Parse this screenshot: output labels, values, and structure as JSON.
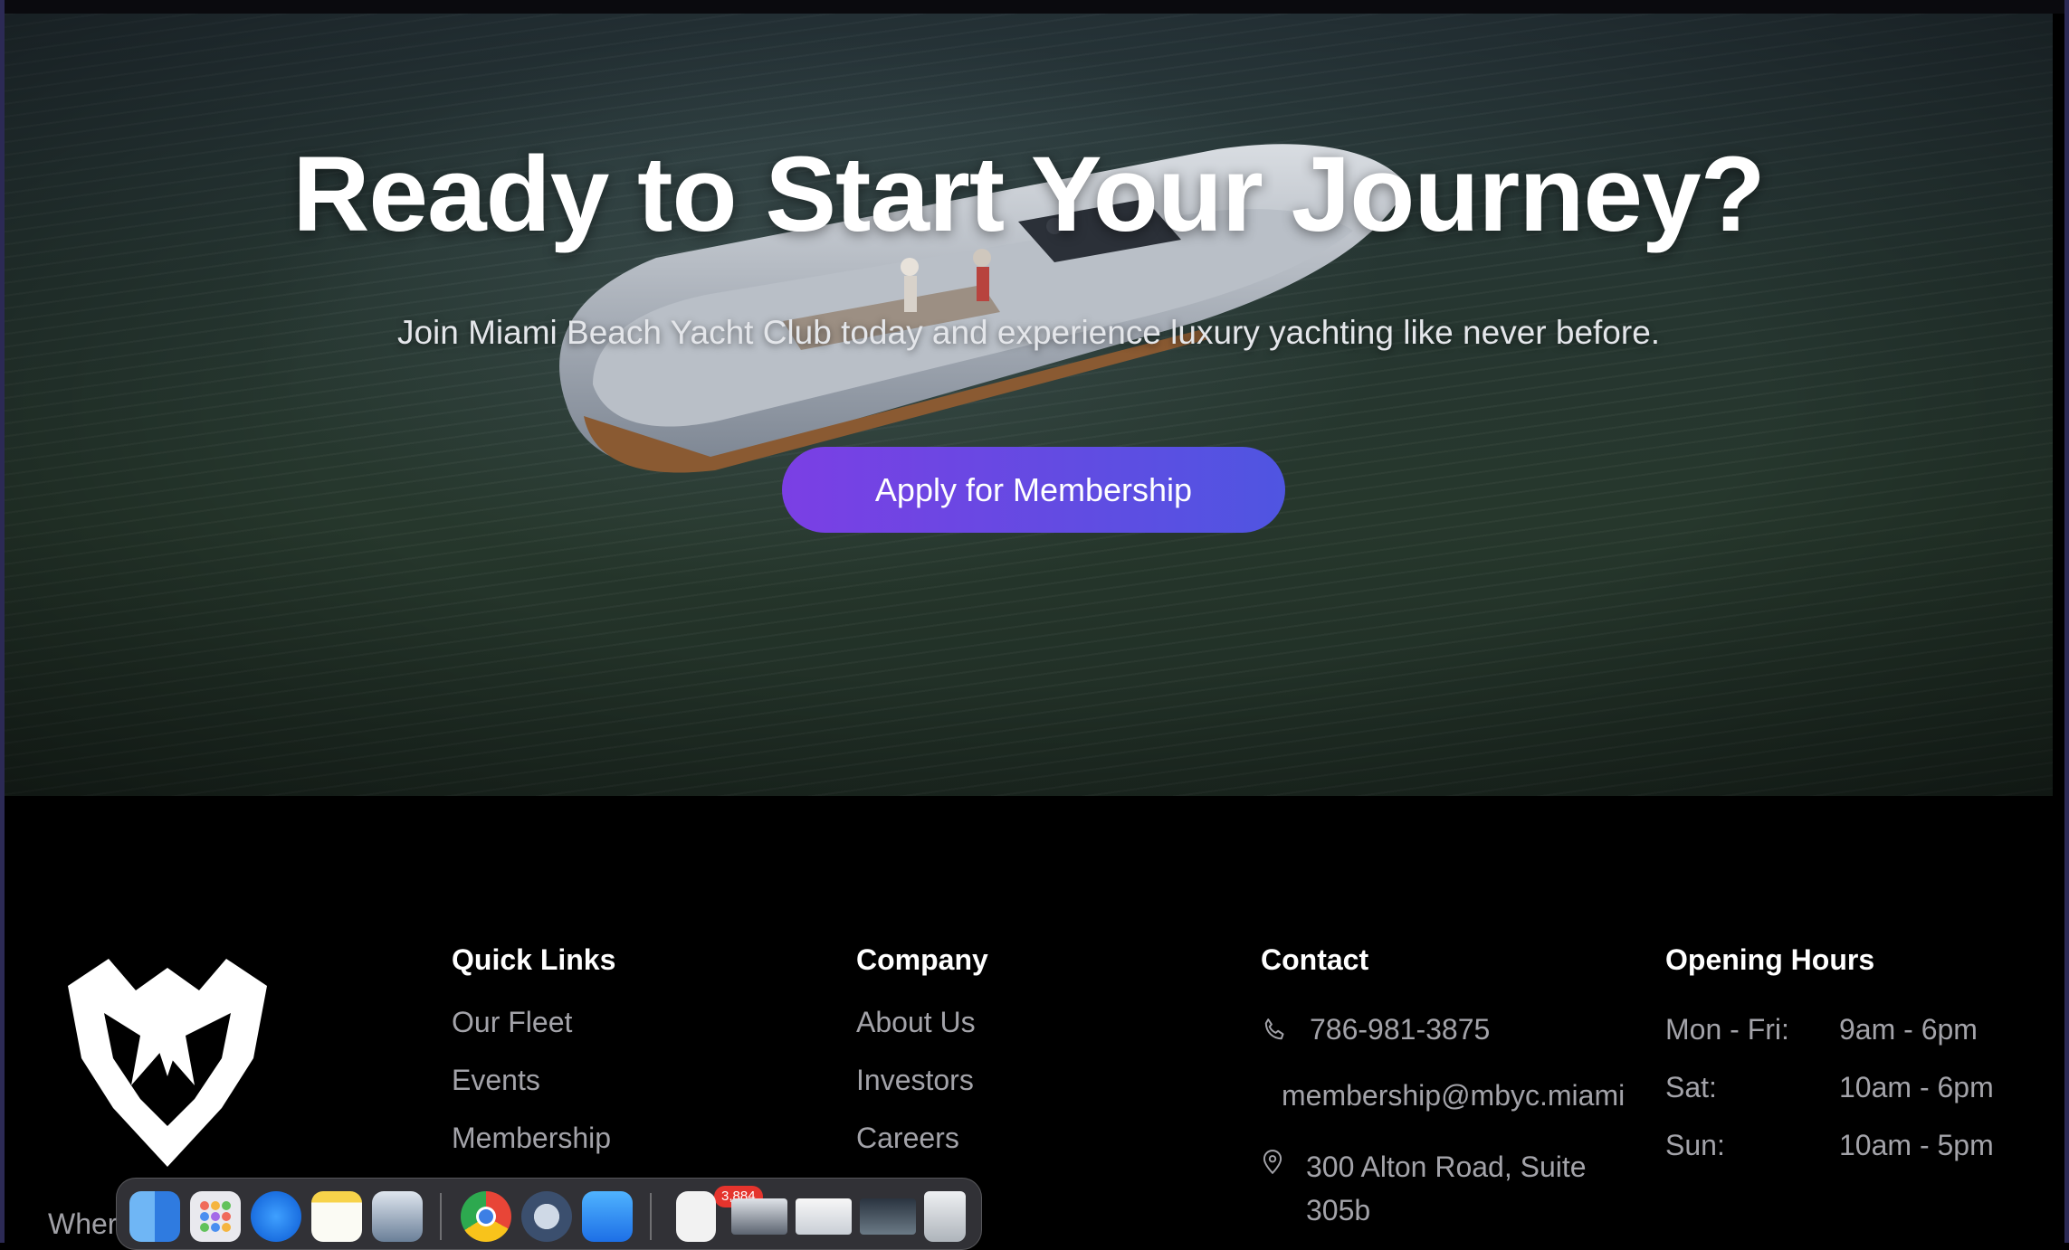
{
  "hero": {
    "title": "Ready to Start Your Journey?",
    "subtitle": "Join Miami Beach Yacht Club today and experience luxury yachting like never before.",
    "cta_label": "Apply for Membership"
  },
  "footer": {
    "tagline_partial": "Wher",
    "quick_links": {
      "heading": "Quick Links",
      "items": [
        "Our Fleet",
        "Events",
        "Membership"
      ]
    },
    "company": {
      "heading": "Company",
      "items": [
        "About Us",
        "Investors",
        "Careers"
      ]
    },
    "contact": {
      "heading": "Contact",
      "phone": "786-981-3875",
      "email": "membership@mbyc.miami",
      "address_line1": "300 Alton Road, Suite",
      "address_line2": "305b"
    },
    "hours": {
      "heading": "Opening Hours",
      "rows": [
        {
          "day": "Mon - Fri:",
          "time": "9am - 6pm"
        },
        {
          "day": "Sat:",
          "time": "10am - 6pm"
        },
        {
          "day": "Sun:",
          "time": "10am - 5pm"
        }
      ]
    }
  },
  "dock": {
    "mail_badge": "3,884",
    "apps": [
      "finder-icon",
      "launchpad-icon",
      "safari-icon",
      "notes-icon",
      "preview-icon",
      "chrome-icon",
      "quicktime-icon",
      "mail-icon",
      "document-icon",
      "window-thumbnail-icon",
      "window-thumbnail-icon",
      "window-thumbnail-icon",
      "trash-icon"
    ]
  },
  "colors": {
    "accent_start": "#7b3fe4",
    "accent_end": "#4f55e1",
    "background": "#000000",
    "muted_text": "#a3a3a9"
  }
}
